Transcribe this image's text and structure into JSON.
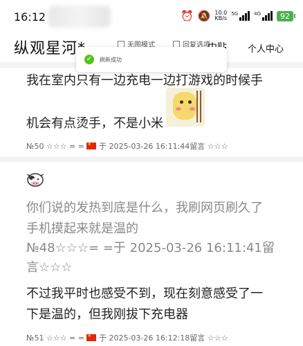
{
  "status_bar": {
    "time": "16:12",
    "net_speed": "10.0",
    "net_unit": "KB/s",
    "sig1_label": "5G",
    "sig2_label": "4G",
    "battery": "92"
  },
  "header": {
    "title": "纵观星河*",
    "tab1": "无图模式",
    "tab2": "回复选项",
    "dots": "中贴",
    "user_center": "个人中心"
  },
  "toast": {
    "text": "刷新成功"
  },
  "posts": [
    {
      "line1": "我在室内只有一边充电一边打游戏的时候手",
      "line2": "机会有点烫手，不是小米",
      "meta": "№50 ☆☆☆ = =  ",
      "meta_date": " 于 2025-03-26 16:11:44留言 ☆☆☆"
    },
    {
      "quote_line1": "你们说的发热到底是什么，我刷网页刷久了",
      "quote_line2": "手机摸起来就是温的",
      "quote_line3": "№48☆☆☆= =于 2025-03-26 16:11:41留",
      "quote_line4": "言☆☆☆",
      "line1": "不过我平时也感受不到，现在刻意感受了一",
      "line2": "下是温的，但我刚拔下充电器",
      "meta": "№51 ☆☆☆ = =  ",
      "meta_date": " 于 2025-03-26 16:12:18留言 ☆☆☆"
    }
  ]
}
